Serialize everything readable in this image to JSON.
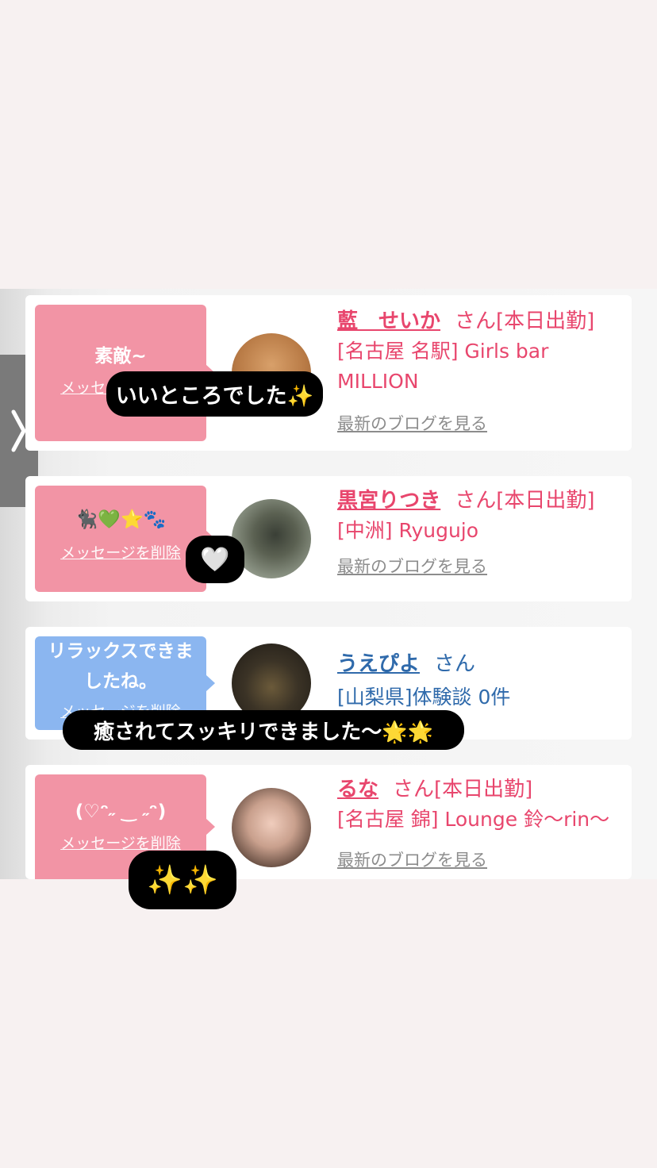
{
  "side_tab": {
    "icon": "chevron-right-icon"
  },
  "cards": [
    {
      "message": "素敵~",
      "delete_label": "メッセージを削除",
      "name": "藍　せいか",
      "honorific": "さん",
      "status": "[本日出勤]",
      "shop": "[名古屋 名駅] Girls bar MILLION",
      "blog_link": "最新のブログを見る"
    },
    {
      "message": "🐈‍⬛💚⭐️🐾",
      "delete_label": "メッセージを削除",
      "name": "黒宮りつき",
      "honorific": "さん",
      "status": "[本日出勤]",
      "shop": "[中洲] Ryugujo",
      "blog_link": "最新のブログを見る"
    },
    {
      "message": "リラックスできましたね。",
      "delete_label": "メッセージを削除",
      "name": "うえぴよ",
      "honorific": "さん",
      "status": "",
      "shop": "[山梨県]体験談 0件",
      "blog_link": ""
    },
    {
      "message": "(♡ᵔ˶ ‿ ˶ᵔ)",
      "delete_label": "メッセージを削除",
      "name": "るな",
      "honorific": "さん",
      "status": "[本日出勤]",
      "shop": "[名古屋 錦] Lounge 鈴〜rin〜",
      "blog_link": "最新のブログを見る"
    }
  ],
  "overlays": [
    {
      "text": "いいところでした✨"
    },
    {
      "text": "🤍"
    },
    {
      "text": "癒されてスッキリできました〜🌟🌟"
    },
    {
      "text": "✨✨"
    }
  ],
  "colors": {
    "accent_pink": "#e8466d",
    "bubble_pink": "#f294a5",
    "bubble_blue": "#8bb6f0",
    "link_blue": "#2f6aab"
  }
}
